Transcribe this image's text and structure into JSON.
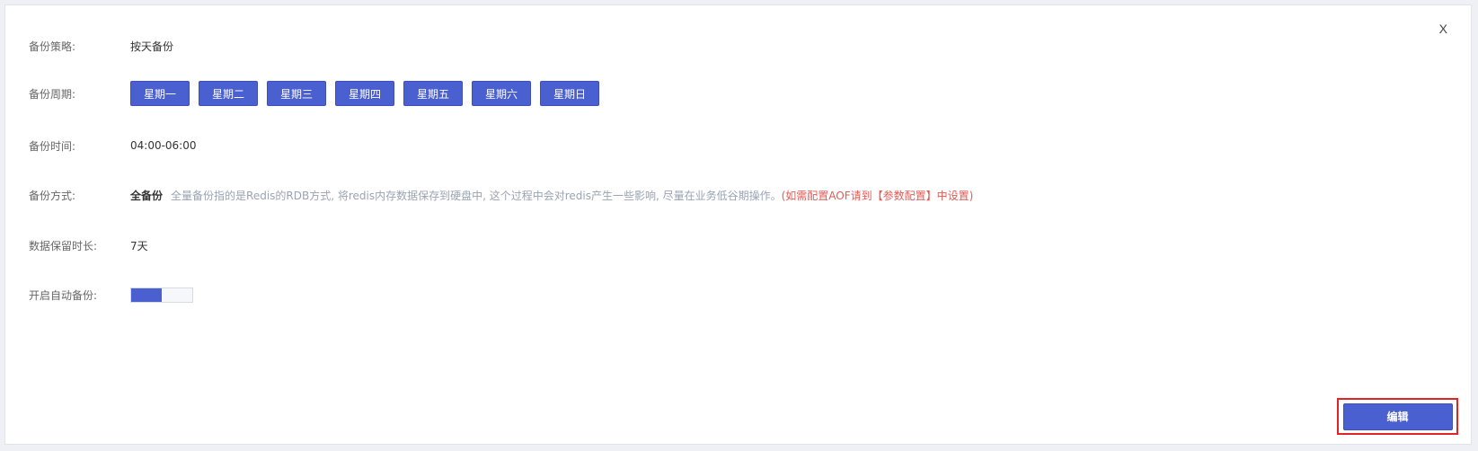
{
  "dialog": {
    "close_label": "X"
  },
  "strategy": {
    "label": "备份策略:",
    "value": "按天备份"
  },
  "cycle": {
    "label": "备份周期:",
    "days": [
      "星期一",
      "星期二",
      "星期三",
      "星期四",
      "星期五",
      "星期六",
      "星期日"
    ]
  },
  "time": {
    "label": "备份时间:",
    "value": "04:00-06:00"
  },
  "mode": {
    "label": "备份方式:",
    "value": "全备份",
    "description": "全量备份指的是Redis的RDB方式, 将redis内存数据保存到硬盘中, 这个过程中会对redis产生一些影响, 尽量在业务低谷期操作。",
    "warning": "(如需配置AOF请到【参数配置】中设置)"
  },
  "retention": {
    "label": "数据保留时长:",
    "value": "7天"
  },
  "auto_backup": {
    "label": "开启自动备份:",
    "enabled": true
  },
  "actions": {
    "edit_label": "编辑"
  },
  "colors": {
    "primary": "#4a5fd0",
    "warning": "#e25a54",
    "highlight_border": "#e02424"
  }
}
